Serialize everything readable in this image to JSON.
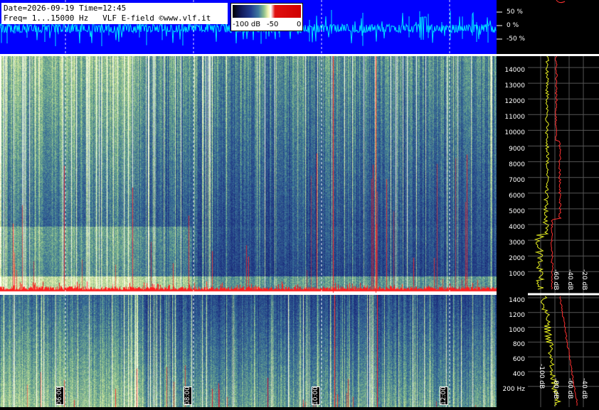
{
  "header": {
    "line1": "Date=2026-09-19 Time=12:45",
    "line2": "Freq= 1...15000 Hz   VLF E-field ©www.vlf.it"
  },
  "colorbar": {
    "labels": [
      "-100 dB",
      "-50",
      "0"
    ]
  },
  "percent_scale": [
    "50 %",
    "0 %",
    "-50 %"
  ],
  "freq_axis_upper": [
    "14000",
    "13000",
    "12000",
    "11000",
    "10000",
    "9000",
    "8000",
    "7000",
    "6000",
    "5000",
    "4000",
    "3000",
    "2000",
    "1000"
  ],
  "freq_axis_lower": [
    "1400",
    "1200",
    "1000",
    "800",
    "600",
    "400",
    "200 Hz"
  ],
  "time_markers": [
    "06:00",
    "08:00",
    "10:00",
    "12:00"
  ],
  "profile_db_upper": [
    "-60 dB",
    "-40 dB",
    "-20 dB"
  ],
  "profile_db_lower": [
    "-100 dB",
    "-80 dB",
    "-60 dB",
    "-40 dB",
    "-20 dB"
  ],
  "colors": {
    "waveform_bg": "#0000ff",
    "waveform_trace": "#00e0ff",
    "trace_yellow": "#e8f020",
    "trace_red": "#ff3030",
    "spike_red": "#ff2020"
  }
}
